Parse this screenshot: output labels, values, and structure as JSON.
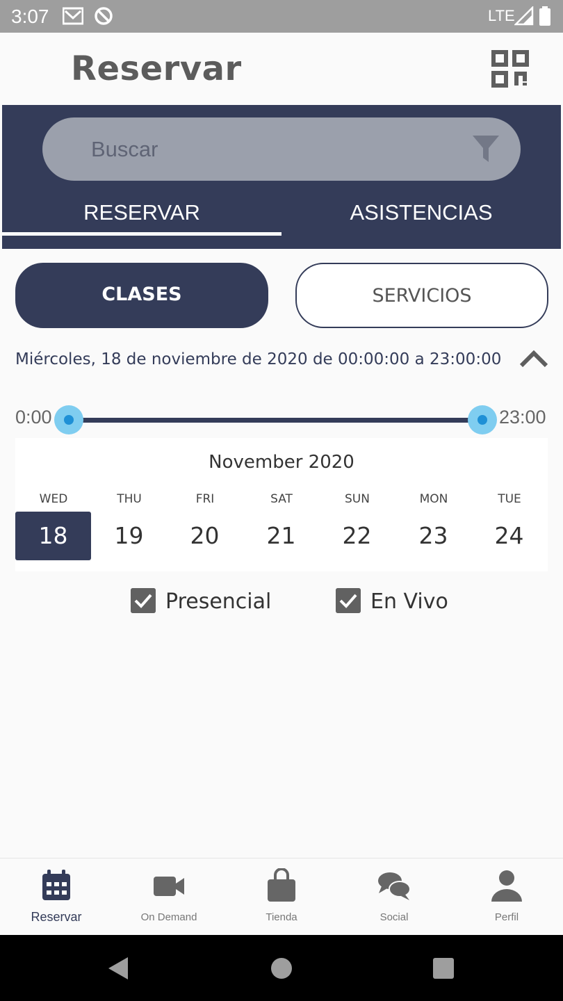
{
  "status_bar": {
    "time": "3:07",
    "network": "LTE",
    "icons": [
      "gmail-icon",
      "sync-off-icon",
      "signal-icon",
      "battery-icon"
    ]
  },
  "app_bar": {
    "title": "Reservar",
    "qr_icon": "qr-code-icon"
  },
  "search": {
    "placeholder": "Buscar",
    "filter_icon": "filter-icon"
  },
  "tabs": [
    {
      "label": "RESERVAR",
      "selected": true
    },
    {
      "label": "ASISTENCIAS",
      "selected": false
    }
  ],
  "segments": [
    {
      "label": "CLASES",
      "selected": true
    },
    {
      "label": "SERVICIOS",
      "selected": false
    }
  ],
  "date_range": {
    "text": "Miércoles, 18 de noviembre de 2020 de 00:00:00 a 23:00:00",
    "collapse_icon": "chevron-up-icon"
  },
  "time_slider": {
    "min_label": "0:00",
    "max_label": "23:00"
  },
  "calendar": {
    "month": "November 2020",
    "days": [
      {
        "dow": "WED",
        "num": "18",
        "selected": true
      },
      {
        "dow": "THU",
        "num": "19"
      },
      {
        "dow": "FRI",
        "num": "20"
      },
      {
        "dow": "SAT",
        "num": "21"
      },
      {
        "dow": "SUN",
        "num": "22"
      },
      {
        "dow": "MON",
        "num": "23"
      },
      {
        "dow": "TUE",
        "num": "24"
      }
    ]
  },
  "filters": [
    {
      "label": "Presencial",
      "checked": true
    },
    {
      "label": "En Vivo",
      "checked": true
    }
  ],
  "bottom_nav": [
    {
      "label": "Reservar",
      "icon": "calendar-icon",
      "active": true
    },
    {
      "label": "On Demand",
      "icon": "video-camera-icon"
    },
    {
      "label": "Tienda",
      "icon": "shopping-bag-icon"
    },
    {
      "label": "Social",
      "icon": "chat-bubbles-icon"
    },
    {
      "label": "Perfil",
      "icon": "person-icon"
    }
  ],
  "colors": {
    "primary": "#343c59",
    "status_bar": "#9e9e9e",
    "slider_thumb": "#7fcdf0",
    "background": "#fafafa"
  }
}
